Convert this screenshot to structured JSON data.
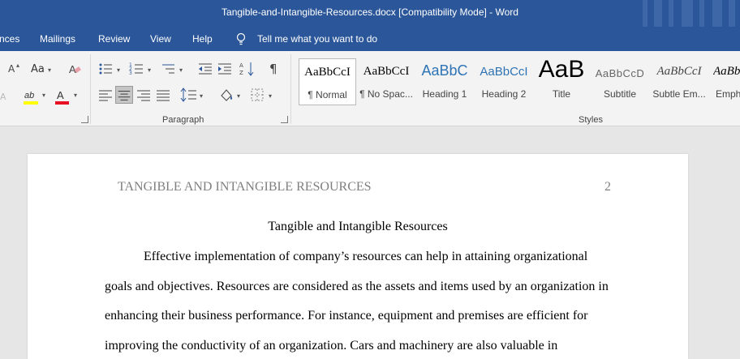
{
  "window": {
    "title": "Tangible-and-Intangible-Resources.docx [Compatibility Mode]  -  Word"
  },
  "menu": {
    "tabs": [
      "nces",
      "Mailings",
      "Review",
      "View",
      "Help"
    ],
    "tell_me": "Tell me what you want to do"
  },
  "ribbon": {
    "font_group": {
      "aa_label": "Aa",
      "grow_label": "A"
    },
    "paragraph_group": {
      "label": "Paragraph",
      "pilcrow": "¶"
    },
    "styles_group": {
      "label": "Styles",
      "items": [
        {
          "preview": "AaBbCcI",
          "label": "¶ Normal",
          "selected": true
        },
        {
          "preview": "AaBbCcI",
          "label": "¶ No Spac..."
        },
        {
          "preview": "AaBbC",
          "label": "Heading 1"
        },
        {
          "preview": "AaBbCcI",
          "label": "Heading 2"
        },
        {
          "preview": "AaB",
          "label": "Title"
        },
        {
          "preview": "AaBbCcD",
          "label": "Subtitle"
        },
        {
          "preview": "AaBbCcI",
          "label": "Subtle Em..."
        },
        {
          "preview": "AaBb",
          "label": "Emph"
        }
      ]
    }
  },
  "colors": {
    "accent": "#2b579a",
    "highlight": "#ffff00",
    "font_color": "#e81123"
  },
  "document": {
    "header_text": "TANGIBLE AND INTANGIBLE RESOURCES",
    "page_number": "2",
    "title": "Tangible and Intangible Resources",
    "lines": [
      "Effective implementation of company’s resources can help in attaining organizational",
      "goals and objectives. Resources are considered as the assets and items used by an organization in",
      "enhancing their business performance. For instance, equipment and premises are efficient for",
      "improving the conductivity of an organization. Cars and machinery are also valuable in"
    ]
  }
}
